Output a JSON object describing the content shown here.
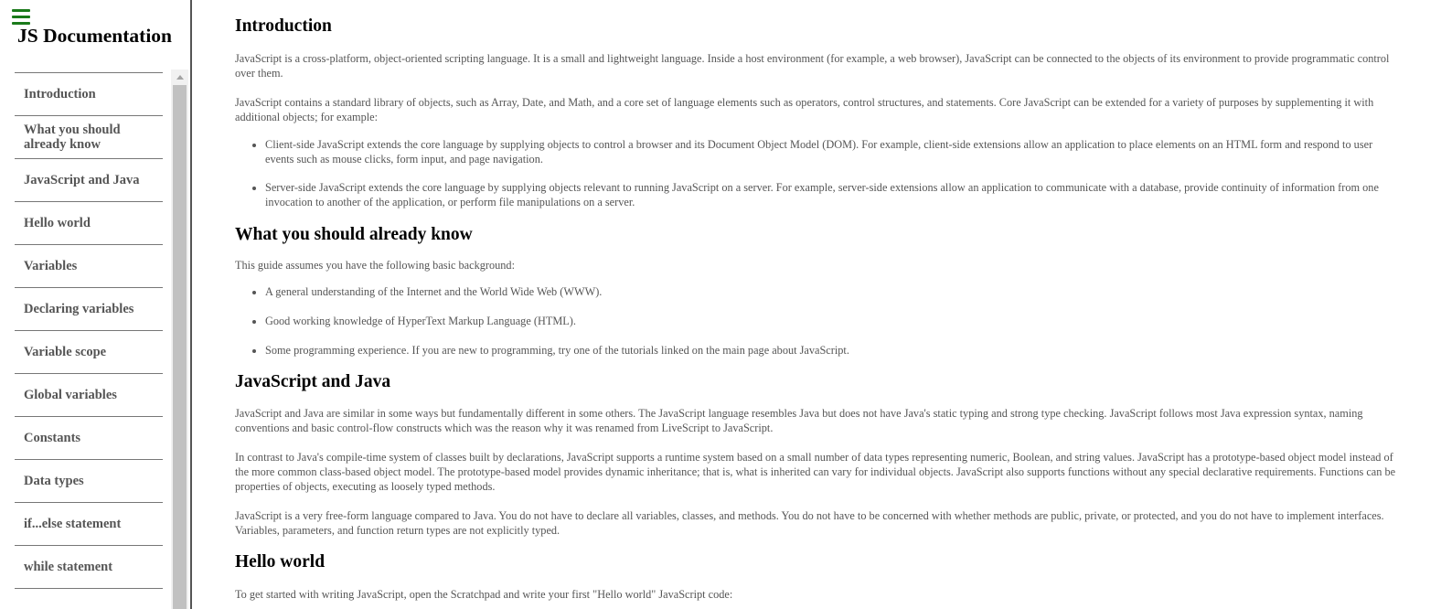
{
  "sidebar": {
    "title": "JS Documentation",
    "items": [
      {
        "label": "Introduction"
      },
      {
        "label": "What you should already know"
      },
      {
        "label": "JavaScript and Java"
      },
      {
        "label": "Hello world"
      },
      {
        "label": "Variables"
      },
      {
        "label": "Declaring variables"
      },
      {
        "label": "Variable scope"
      },
      {
        "label": "Global variables"
      },
      {
        "label": "Constants"
      },
      {
        "label": "Data types"
      },
      {
        "label": "if...else statement"
      },
      {
        "label": "while statement"
      }
    ]
  },
  "main": {
    "sections": [
      {
        "title": "Introduction",
        "p1": "JavaScript is a cross-platform, object-oriented scripting language. It is a small and lightweight language. Inside a host environment (for example, a web browser), JavaScript can be connected to the objects of its environment to provide programmatic control over them.",
        "p2": "JavaScript contains a standard library of objects, such as Array, Date, and Math, and a core set of language elements such as operators, control structures, and statements. Core JavaScript can be extended for a variety of purposes by supplementing it with additional objects; for example:",
        "bullets": [
          "Client-side JavaScript extends the core language by supplying objects to control a browser and its Document Object Model (DOM). For example, client-side extensions allow an application to place elements on an HTML form and respond to user events such as mouse clicks, form input, and page navigation.",
          "Server-side JavaScript extends the core language by supplying objects relevant to running JavaScript on a server. For example, server-side extensions allow an application to communicate with a database, provide continuity of information from one invocation to another of the application, or perform file manipulations on a server."
        ]
      },
      {
        "title": "What you should already know",
        "p1": "This guide assumes you have the following basic background:",
        "bullets": [
          "A general understanding of the Internet and the World Wide Web (WWW).",
          "Good working knowledge of HyperText Markup Language (HTML).",
          "Some programming experience. If you are new to programming, try one of the tutorials linked on the main page about JavaScript."
        ]
      },
      {
        "title": "JavaScript and Java",
        "p1": "JavaScript and Java are similar in some ways but fundamentally different in some others. The JavaScript language resembles Java but does not have Java's static typing and strong type checking. JavaScript follows most Java expression syntax, naming conventions and basic control-flow constructs which was the reason why it was renamed from LiveScript to JavaScript.",
        "p2": "In contrast to Java's compile-time system of classes built by declarations, JavaScript supports a runtime system based on a small number of data types representing numeric, Boolean, and string values. JavaScript has a prototype-based object model instead of the more common class-based object model. The prototype-based model provides dynamic inheritance; that is, what is inherited can vary for individual objects. JavaScript also supports functions without any special declarative requirements. Functions can be properties of objects, executing as loosely typed methods.",
        "p3": "JavaScript is a very free-form language compared to Java. You do not have to declare all variables, classes, and methods. You do not have to be concerned with whether methods are public, private, or protected, and you do not have to implement interfaces. Variables, parameters, and function return types are not explicitly typed."
      },
      {
        "title": "Hello world",
        "p1": "To get started with writing JavaScript, open the Scratchpad and write your first \"Hello world\" JavaScript code:"
      }
    ]
  }
}
